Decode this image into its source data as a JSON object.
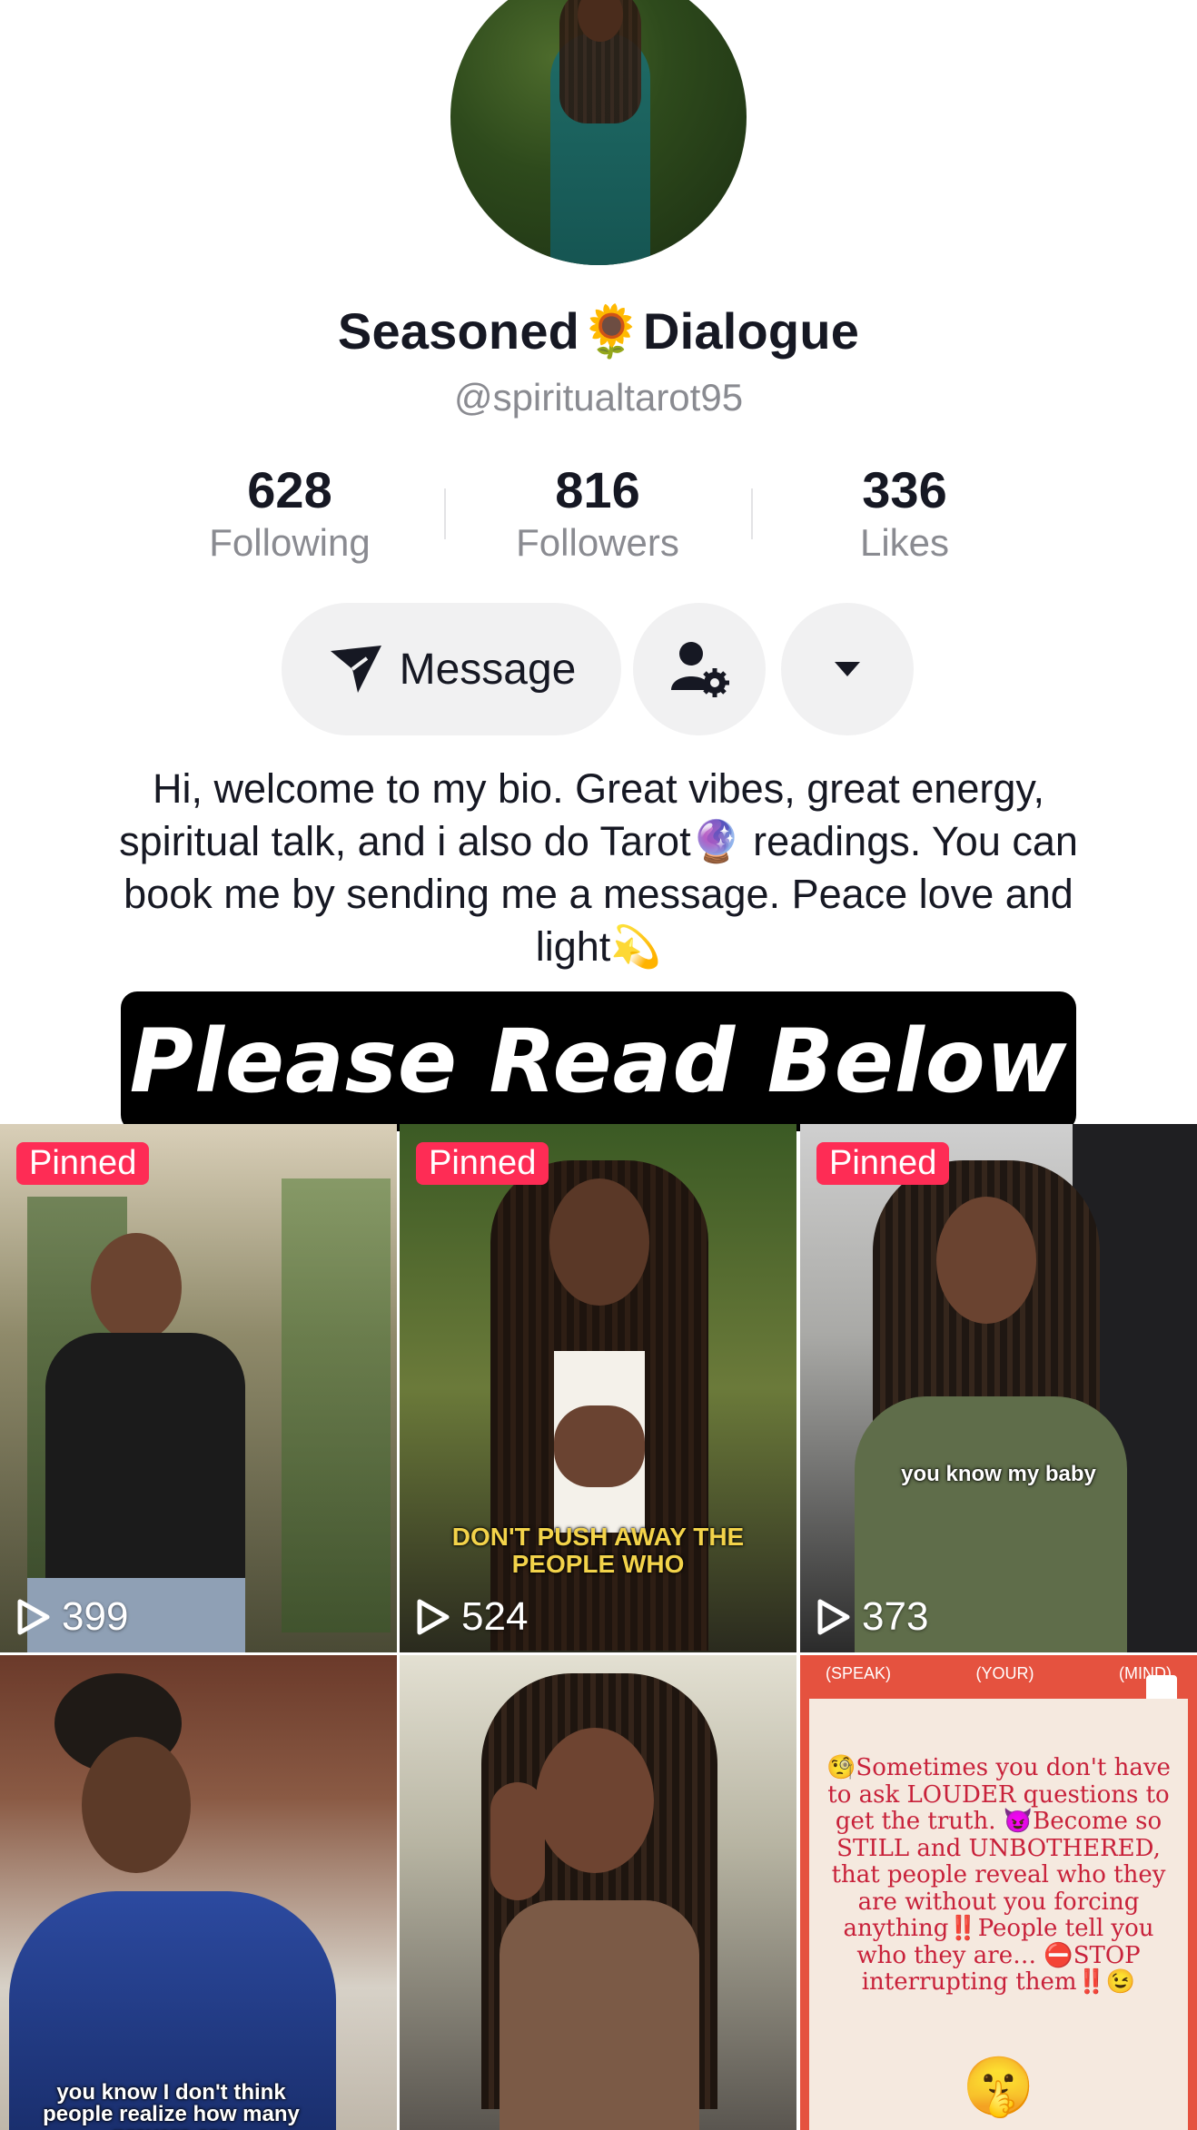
{
  "profile": {
    "display_name": "Seasoned🌻Dialogue",
    "username": "@spiritualtarot95",
    "stats": [
      {
        "value": "628",
        "label": "Following"
      },
      {
        "value": "816",
        "label": "Followers"
      },
      {
        "value": "336",
        "label": "Likes"
      }
    ],
    "actions": {
      "message_label": "Message"
    },
    "bio": "Hi, welcome to my bio. Great vibes, great energy, spiritual talk, and i also do Tarot🔮 readings. You can book me by sending me a message. Peace love and light💫",
    "banner_text": "Please Read Below"
  },
  "videos": [
    {
      "pinned_label": "Pinned",
      "views": "399"
    },
    {
      "pinned_label": "Pinned",
      "views": "524",
      "caption": "DON'T PUSH AWAY THE PEOPLE WHO"
    },
    {
      "pinned_label": "Pinned",
      "views": "373",
      "caption": "you know my baby"
    },
    {
      "caption": "you know I don't think people realize how many prayers are"
    },
    {},
    {
      "header": [
        "(SPEAK)",
        "(YOUR)",
        "(MIND)"
      ],
      "quote": "🧐Sometimes you don't have to ask LOUDER questions to get the truth. 😈Become so STILL and UNBOTHERED, that people reveal who they are without you forcing anything‼️People tell you who they are… ⛔STOP interrupting them‼️😉",
      "emoji": "🤫"
    }
  ],
  "colors": {
    "accent": "#fe2c55",
    "muted": "#8a8b91",
    "button_bg": "#f1f1f2"
  },
  "icons": [
    "back-icon",
    "share-icon",
    "send-icon",
    "add-friend-settings-icon",
    "dropdown-caret-icon",
    "play-icon",
    "carousel-icon"
  ]
}
